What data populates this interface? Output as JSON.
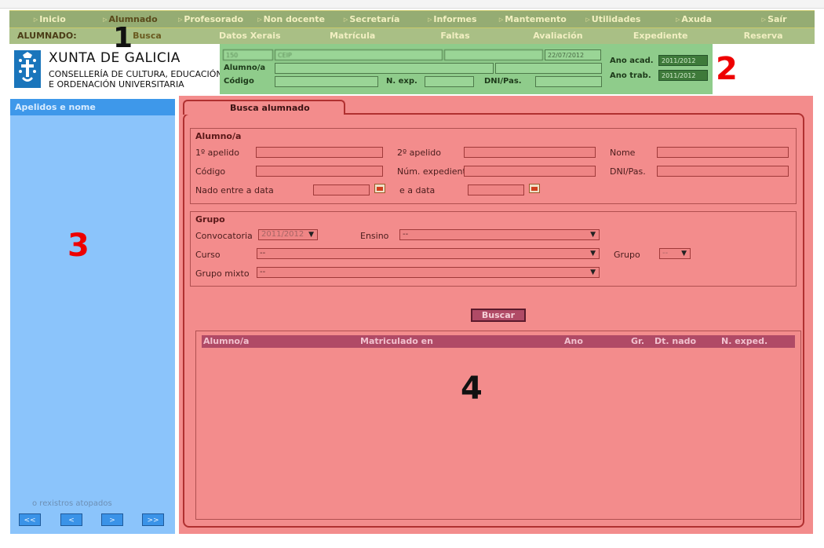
{
  "menu": {
    "items": [
      {
        "label": "Inicio"
      },
      {
        "label": "Alumnado"
      },
      {
        "label": "Profesorado"
      },
      {
        "label": "Non docente"
      },
      {
        "label": "Secretaría"
      },
      {
        "label": "Informes"
      },
      {
        "label": "Mantemento"
      },
      {
        "label": "Utilidades"
      },
      {
        "label": "Axuda"
      },
      {
        "label": "Saír"
      }
    ]
  },
  "submenu": {
    "title": "ALUMNADO:",
    "items": [
      {
        "label": "Busca"
      },
      {
        "label": "Datos Xerais"
      },
      {
        "label": "Matrícula"
      },
      {
        "label": "Faltas"
      },
      {
        "label": "Avaliación"
      },
      {
        "label": "Expediente"
      },
      {
        "label": "Reserva"
      }
    ]
  },
  "markers": {
    "m1": "1",
    "m2": "2",
    "m3": "3",
    "m4": "4"
  },
  "logo": {
    "title": "XUNTA DE GALICIA",
    "line1": "CONSELLERÍA DE CULTURA, EDUCACIÓN",
    "line2": "E ORDENACIÓN UNIVERSITARIA"
  },
  "info": {
    "code": "150",
    "school": "CEIP",
    "place": "",
    "date": "22/07/2012",
    "alumno_label": "Alumno/a",
    "codigo_label": "Código",
    "nexp_label": "N. exp.",
    "dni_label": "DNI/Pas.",
    "ano_acad_label": "Ano acad.",
    "ano_acad": "2011/2012",
    "ano_trab_label": "Ano trab.",
    "ano_trab": "2011/2012"
  },
  "sidebar": {
    "header": "Apelidos e nome",
    "count_text": "o rexistros atopados",
    "nav": {
      "first": "<<",
      "prev": "<",
      "next": ">",
      "last": ">>"
    }
  },
  "search": {
    "tab": "Busca alumnado",
    "alumno": {
      "legend": "Alumno/a",
      "apelido1": "1º apelido",
      "apelido2": "2º apelido",
      "nome": "Nome",
      "codigo": "Código",
      "num_exp": "Núm. expediente",
      "dni": "DNI/Pas.",
      "nado_entre": "Nado entre a data",
      "e_a_data": "e a data"
    },
    "grupo": {
      "legend": "Grupo",
      "convocatoria": "Convocatoria",
      "convocatoria_value": "2011/2012",
      "ensino": "Ensino",
      "ensino_value": "--",
      "curso": "Curso",
      "curso_value": "--",
      "grupo": "Grupo",
      "grupo_value": "--",
      "grupo_mixto": "Grupo mixto",
      "grupo_mixto_value": "--"
    },
    "button": "Buscar",
    "results": {
      "columns": [
        "Alumno/a",
        "Matriculado en",
        "Ano",
        "Gr.",
        "Dt. nado",
        "N. exped."
      ]
    }
  },
  "colors": {
    "marker_red": "#ee0000",
    "marker_black": "#111111"
  }
}
